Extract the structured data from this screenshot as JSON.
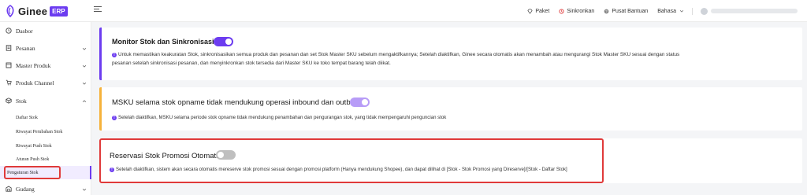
{
  "header": {
    "brand": "Ginee",
    "brand_badge": "ERP",
    "paket_label": "Paket",
    "sinkronkan_label": "Sinkronkan",
    "pusat_bantuan_label": "Pusat Bantuan",
    "bahasa_label": "Bahasa"
  },
  "sidebar": {
    "items": [
      {
        "label": "Dasbor",
        "icon": "home-icon"
      },
      {
        "label": "Pesanan",
        "icon": "document-icon"
      },
      {
        "label": "Master Produk",
        "icon": "box-icon"
      },
      {
        "label": "Produk Channel",
        "icon": "cart-icon"
      },
      {
        "label": "Stok",
        "icon": "cube-icon"
      }
    ],
    "stok_sub": [
      {
        "label": "Daftar Stok"
      },
      {
        "label": "Riwayat Perubahan Stok"
      },
      {
        "label": "Riwayat Push Stok"
      },
      {
        "label": "Aturan Push Stok"
      },
      {
        "label": "Pengaturan Stok"
      }
    ],
    "gudang_label": "Gudang"
  },
  "cards": {
    "monitor": {
      "title": "Monitor Stok dan Sinkronisasi",
      "toggle_on": true,
      "info_line1": "Untuk memastikan keakuratan Stok, sinkronisasikan semua produk dan pesanan dan set Stok Master SKU sebelum mengaktifkannya; Setelah diaktifkan, Ginee secara otomatis akan menambah atau mengurangi Stok Master SKU sesuai dengan status",
      "info_line2": "pesanan setelah sinkronisasi pesanan, dan menyinkronkan stok tersedia dari Master SKU ke toko tempat barang telah diikat."
    },
    "opname": {
      "title": "MSKU selama stok opname tidak mendukung operasi inbound dan outbound",
      "toggle_on": true,
      "info": "Setelah diaktifkan, MSKU selama periode stok opname tidak mendukung penambahan dan pengurangan stok, yang tidak mempengaruhi penguncian stok"
    },
    "reservasi": {
      "title": "Reservasi Stok Promosi Otomatis",
      "toggle_on": false,
      "info": "Setelah diaktifkan, sistem akan secara otomatis mereserve stok promosi sesuai dengan promosi platform (Hanya mendukung Shopee), dan dapat dilihat di [Stok - Stok Promosi yang Direserve]/[Stok - Daftar Stok]"
    }
  },
  "colors": {
    "accent": "#6c3cf0",
    "warning": "#f6b23a",
    "highlight": "#e03a3a"
  }
}
